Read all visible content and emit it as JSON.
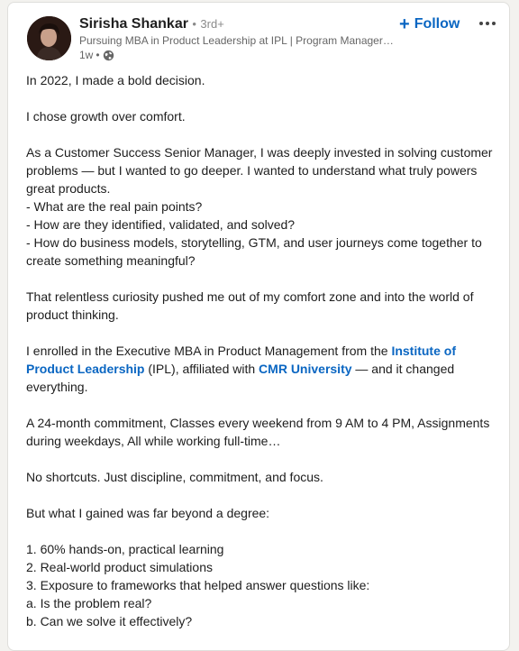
{
  "post": {
    "author_name": "Sirisha Shankar",
    "separator": "•",
    "degree": "3rd+",
    "headline": "Pursuing MBA in Product Leadership at IPL | Program Manager |...",
    "timestamp": "1w",
    "meta_separator": "•",
    "visibility_icon": "globe-icon",
    "follow_label": "Follow",
    "follow_icon": "plus-icon",
    "more_icon": "ellipsis-icon",
    "link_color": "#0a66c2",
    "lines": [
      {
        "text": "In 2022, I made a bold decision."
      },
      {
        "text": ""
      },
      {
        "text": "I chose growth over comfort."
      },
      {
        "text": ""
      },
      {
        "text": "As a Customer Success Senior Manager, I was deeply invested in solving customer"
      },
      {
        "text": "problems — but I wanted to go deeper. I wanted to understand what truly powers"
      },
      {
        "text": "great products."
      },
      {
        "text": "- What are the real pain points?"
      },
      {
        "text": "- How are they identified, validated, and solved?"
      },
      {
        "text": "- How do business models, storytelling, GTM, and user journeys come together to"
      },
      {
        "text": "create something meaningful?"
      },
      {
        "text": ""
      },
      {
        "text": "That relentless curiosity pushed me out of my comfort zone and into the world of"
      },
      {
        "text": "product thinking."
      },
      {
        "text": ""
      },
      {
        "text": "I enrolled in the Executive MBA in Product Management from the ",
        "link": "Institute of",
        "after": ""
      },
      {
        "text": "",
        "link": "Product Leadership",
        "after": " (IPL), affiliated with ",
        "link2": "CMR University",
        "after2": " — and it changed"
      },
      {
        "text": "everything."
      },
      {
        "text": ""
      },
      {
        "text": "A 24-month commitment, Classes every weekend from 9 AM to 4 PM, Assignments"
      },
      {
        "text": "during weekdays, All while working full-time…"
      },
      {
        "text": ""
      },
      {
        "text": "No shortcuts. Just discipline, commitment, and focus."
      },
      {
        "text": ""
      },
      {
        "text": "But what I gained was far beyond a degree:"
      },
      {
        "text": ""
      },
      {
        "text": "1. 60% hands-on, practical learning"
      },
      {
        "text": "2. Real-world product simulations"
      },
      {
        "text": "3. Exposure to frameworks that helped answer questions like:"
      },
      {
        "text": "a. Is the problem real?"
      },
      {
        "text": "b. Can we solve it effectively?"
      }
    ]
  }
}
